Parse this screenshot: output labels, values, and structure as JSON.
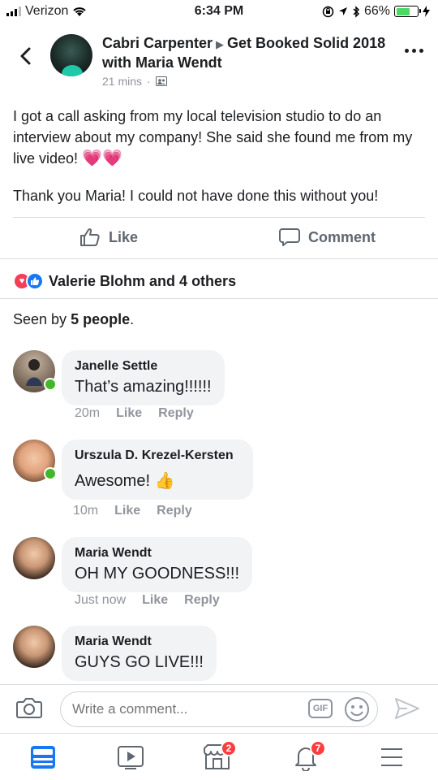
{
  "status_bar": {
    "carrier": "Verizon",
    "time": "6:34 PM",
    "battery": "66%",
    "battery_level": 0.66
  },
  "header": {
    "author": "Cabri Carpenter",
    "group": "Get Booked Solid 2018 with Maria Wendt",
    "timestamp": "21 mins",
    "separator": "·"
  },
  "post": {
    "paragraph1": "I got a call asking from my local television studio to do an interview about my company! She said she found me from my live video!",
    "hearts": "💗💗",
    "paragraph2": "Thank you Maria! I could not have done this without you!"
  },
  "actions": {
    "like_label": "Like",
    "comment_label": "Comment"
  },
  "reactions": {
    "summary": "Valerie Blohm and 4 others"
  },
  "seen": {
    "prefix": "Seen by ",
    "count": "5 people",
    "suffix": "."
  },
  "comments": [
    {
      "name": "Janelle Settle",
      "text": "That’s amazing!!!!!!",
      "time": "20m",
      "like": "Like",
      "reply": "Reply"
    },
    {
      "name": "Urszula D. Krezel-Kersten",
      "text": "Awesome!",
      "emoji": "👍",
      "time": "10m",
      "like": "Like",
      "reply": "Reply"
    },
    {
      "name": "Maria Wendt",
      "text": "OH MY GOODNESS!!!",
      "time": "Just now",
      "like": "Like",
      "reply": "Reply"
    },
    {
      "name": "Maria Wendt",
      "text": "GUYS GO LIVE!!!"
    }
  ],
  "composer": {
    "placeholder": "Write a comment...",
    "gif_label": "GIF"
  },
  "tabbar": {
    "marketplace_badge": "2",
    "notifications_badge": "7"
  },
  "colors": {
    "brand_blue": "#1877f2",
    "badge_red": "#fa3e3e",
    "online_green": "#42b72a"
  }
}
